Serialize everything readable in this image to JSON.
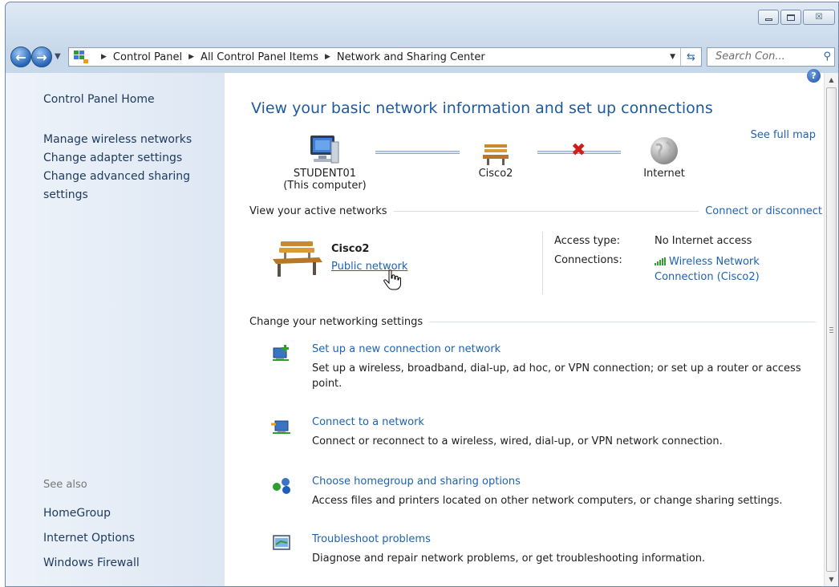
{
  "window": {
    "caption_buttons": {
      "minimize_icon": "minimize-icon",
      "maximize_icon": "maximize-icon",
      "close_glyph": "☒"
    }
  },
  "nav": {
    "breadcrumbs": [
      "Control Panel",
      "All Control Panel Items",
      "Network and Sharing Center"
    ],
    "search_placeholder": "Search Con...",
    "refresh_glyph": "⇆"
  },
  "sidebar": {
    "home": "Control Panel Home",
    "tasks": [
      "Manage wireless networks",
      "Change adapter settings",
      "Change advanced sharing settings"
    ],
    "see_also_label": "See also",
    "see_also": [
      "HomeGroup",
      "Internet Options",
      "Windows Firewall"
    ]
  },
  "main": {
    "title": "View your basic network information and set up connections",
    "see_full_map": "See full map",
    "map": {
      "computer_name": "STUDENT01",
      "computer_sub": "(This computer)",
      "network_name": "Cisco2",
      "internet_label": "Internet"
    },
    "active_networks": {
      "heading": "View your active networks",
      "connect_link": "Connect or disconnect",
      "network_name": "Cisco2",
      "network_type": "Public network",
      "access_type_label": "Access type:",
      "access_type_value": "No Internet access",
      "connections_label": "Connections:",
      "connection_link": "Wireless Network Connection (Cisco2)"
    },
    "change_settings": {
      "heading": "Change your networking settings",
      "tasks": [
        {
          "title": "Set up a new connection or network",
          "desc": "Set up a wireless, broadband, dial-up, ad hoc, or VPN connection; or set up a router or access point.",
          "icon": "new-connection-icon"
        },
        {
          "title": "Connect to a network",
          "desc": "Connect or reconnect to a wireless, wired, dial-up, or VPN network connection.",
          "icon": "connect-network-icon"
        },
        {
          "title": "Choose homegroup and sharing options",
          "desc": "Access files and printers located on other network computers, or change sharing settings.",
          "icon": "homegroup-icon"
        },
        {
          "title": "Troubleshoot problems",
          "desc": "Diagnose and repair network problems, or get troubleshooting information.",
          "icon": "troubleshoot-icon"
        }
      ]
    }
  },
  "colors": {
    "link": "#1e62b3",
    "title": "#1e5a9c",
    "sidebar_text": "#1e395b",
    "error_x": "#d21c1c",
    "signal": "#2f9d31"
  }
}
